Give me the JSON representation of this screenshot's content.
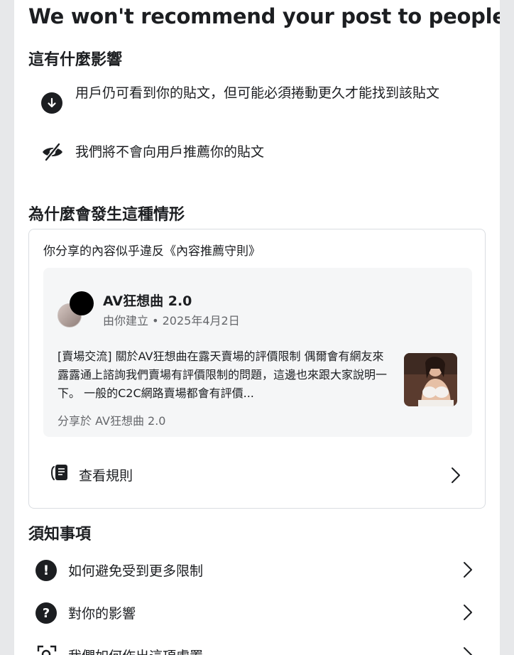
{
  "header": {
    "title": "We won't recommend your post to people"
  },
  "impact": {
    "heading": "這有什麼影響",
    "items": [
      {
        "icon": "arrow-down-circle-icon",
        "text": "用戶仍可看到你的貼文，但可能必須捲動更久才能找到該貼文"
      },
      {
        "icon": "eye-slash-icon",
        "text": "我們將不會向用戶推薦你的貼文"
      }
    ]
  },
  "reason": {
    "heading": "為什麼會發生這種情形",
    "card_title": "你分享的內容似乎違反《內容推薦守則》",
    "post": {
      "group_name": "AV狂想曲 2.0",
      "meta": "由你建立 • 2025年4月2日",
      "body": "[賣場交流] 關於AV狂想曲在露天賣場的評價限制 偶爾會有網友來露露通上諮詢我們賣場有評價限制的問題，這邊也來跟大家說明一下。 一般的C2C網路賣場都會有評價...",
      "shared_in": "分享於 AV狂想曲 2.0"
    },
    "view_rules_label": "查看規則"
  },
  "notes": {
    "heading": "須知事項",
    "items": [
      {
        "icon": "exclamation-circle-icon",
        "label": "如何避免受到更多限制"
      },
      {
        "icon": "question-circle-icon",
        "label": "對你的影響"
      },
      {
        "icon": "review-scan-icon",
        "label": "我們如何作出這項處置"
      }
    ]
  },
  "colors": {
    "page_bg": "#e7e8ea",
    "panel_bg": "#ffffff",
    "text_primary": "#1c1e21",
    "text_secondary": "#65676b",
    "post_bg": "#f5f6f7",
    "border": "#dadde1"
  }
}
